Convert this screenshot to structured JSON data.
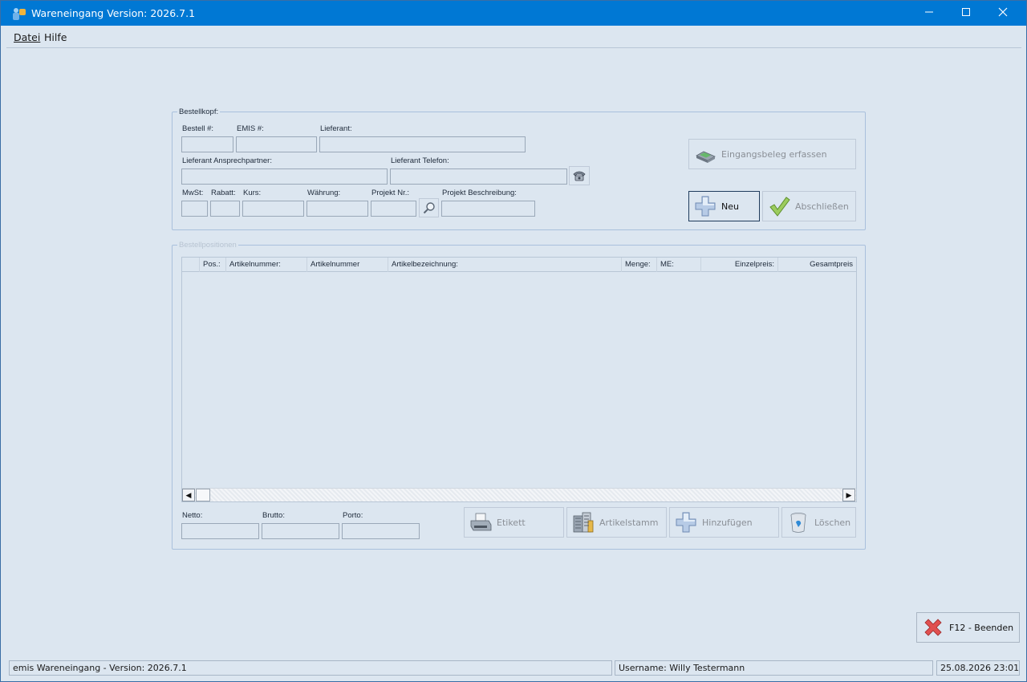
{
  "window": {
    "title": "Wareneingang Version: 2026.7.1"
  },
  "menu": {
    "items": [
      "Datei",
      "Hilfe"
    ]
  },
  "bestellkopf": {
    "legend": "Bestellkopf:",
    "labels": {
      "bestell_nr": "Bestell #:",
      "emis_nr": "EMIS #:",
      "lieferant": "Lieferant:",
      "ansprechpartner": "Lieferant Ansprechpartner:",
      "telefon": "Lieferant Telefon:",
      "mwst": "MwSt:",
      "rabatt": "Rabatt:",
      "kurs": "Kurs:",
      "waehrung": "Währung:",
      "projekt_nr": "Projekt Nr.:",
      "projekt_beschreibung": "Projekt Beschreibung:"
    },
    "values": {
      "bestell_nr": "",
      "emis_nr": "",
      "lieferant": "",
      "ansprechpartner": "",
      "telefon": "",
      "mwst": "",
      "rabatt": "",
      "kurs": "",
      "waehrung": "",
      "projekt_nr": "",
      "projekt_beschreibung": ""
    }
  },
  "buttons": {
    "eingangsbeleg": "Eingangsbeleg erfassen",
    "neu": "Neu",
    "abschliessen": "Abschließen",
    "etikett": "Etikett",
    "artikelstamm": "Artikelstamm",
    "hinzufuegen": "Hinzufügen",
    "loeschen": "Löschen",
    "beenden": "F12 - Beenden"
  },
  "positionen": {
    "legend": "Bestellpositionen",
    "columns": [
      "",
      "Pos.:",
      "Artikelnummer:",
      "Artikelnummer",
      "Artikelbezeichnung:",
      "Menge:",
      "ME:",
      "Einzelpreis:",
      "Gesamtpreis"
    ],
    "rows": []
  },
  "summen": {
    "labels": {
      "netto": "Netto:",
      "brutto": "Brutto:",
      "porto": "Porto:"
    },
    "values": {
      "netto": "",
      "brutto": "",
      "porto": ""
    }
  },
  "statusbar": {
    "app": "emis Wareneingang - Version: 2026.7.1",
    "user": "Username: Willy Testermann",
    "datetime": "25.08.2026 23:01"
  },
  "colors": {
    "titlebar": "#0078d4",
    "background": "#dce6f0",
    "border": "#a9c0dc"
  }
}
